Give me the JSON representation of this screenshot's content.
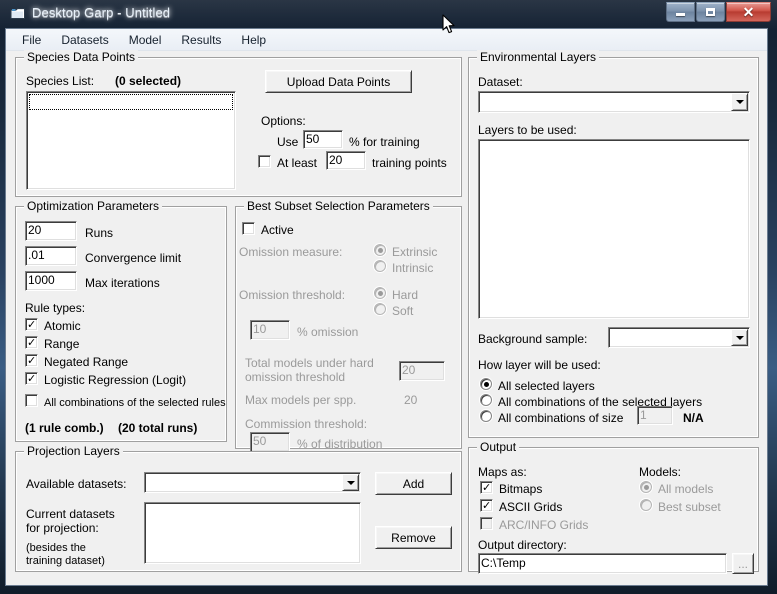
{
  "window": {
    "title": "Desktop Garp - Untitled",
    "icon": "document-window-icon",
    "minimize_label": "Minimize",
    "maximize_label": "Maximize",
    "close_label": "✕"
  },
  "menu": {
    "items": [
      {
        "label": "File"
      },
      {
        "label": "Datasets"
      },
      {
        "label": "Model"
      },
      {
        "label": "Results"
      },
      {
        "label": "Help"
      }
    ]
  },
  "species_data_points": {
    "title": "Species Data Points",
    "species_list_label": "Species List:",
    "selected_count_label": "(0 selected)",
    "species_list_value": "",
    "upload_button": "Upload Data Points",
    "options_label": "Options:",
    "use_label": "Use",
    "training_percent": "50",
    "percent_for_training_label": "% for training",
    "at_least_label": "At least",
    "at_least_checked": false,
    "min_training_points": "20",
    "training_points_label": "training points"
  },
  "optimization_parameters": {
    "title": "Optimization Parameters",
    "runs_value": "20",
    "runs_label": "Runs",
    "convergence_value": ".01",
    "convergence_label": "Convergence limit",
    "max_iterations_value": "1000",
    "max_iterations_label": "Max iterations",
    "rule_types_label": "Rule types:",
    "rules": [
      {
        "label": "Atomic",
        "checked": true
      },
      {
        "label": "Range",
        "checked": true
      },
      {
        "label": "Negated Range",
        "checked": true
      },
      {
        "label": "Logistic Regression (Logit)",
        "checked": true
      }
    ],
    "all_combinations_label": "All combinations of the selected rules",
    "all_combinations_checked": false,
    "rule_comb_summary": "(1 rule comb.)",
    "total_runs_summary": "(20 total runs)"
  },
  "best_subset": {
    "title": "Best Subset Selection Parameters",
    "active_label": "Active",
    "active_checked": false,
    "omission_measure_label": "Omission measure:",
    "omission_measure_options": [
      {
        "label": "Extrinsic",
        "selected": true
      },
      {
        "label": "Intrinsic",
        "selected": false
      }
    ],
    "omission_threshold_label": "Omission threshold:",
    "omission_threshold_options": [
      {
        "label": "Hard",
        "selected": true
      },
      {
        "label": "Soft",
        "selected": false
      }
    ],
    "percent_omission_value": "10",
    "percent_omission_label": "% omission",
    "total_models_label_line1": "Total models under hard",
    "total_models_label_line2": "omission threshold",
    "total_models_value": "20",
    "max_models_label": "Max models per spp.",
    "max_models_value": "20",
    "commission_threshold_label": "Commission threshold:",
    "commission_value": "50",
    "commission_suffix_label": "% of distribution"
  },
  "environmental_layers": {
    "title": "Environmental Layers",
    "dataset_label": "Dataset:",
    "dataset_value": "",
    "layers_label": "Layers to be used:",
    "layers_value": "",
    "background_sample_label": "Background sample:",
    "background_sample_value": "",
    "how_layer_label": "How layer will be used:",
    "usage_options": [
      {
        "label": "All selected layers",
        "selected": true
      },
      {
        "label": "All combinations of the selected layers",
        "selected": false
      },
      {
        "label": "All combinations of size",
        "selected": false
      }
    ],
    "combination_size_value": "1",
    "na_label": "N/A"
  },
  "projection_layers": {
    "title": "Projection Layers",
    "available_datasets_label": "Available datasets:",
    "available_datasets_value": "",
    "add_button": "Add",
    "current_datasets_label_line1": "Current datasets",
    "current_datasets_label_line2": "for projection:",
    "current_datasets_note_line1": "(besides the",
    "current_datasets_note_line2": "training dataset)",
    "current_datasets_value": "",
    "remove_button": "Remove"
  },
  "output": {
    "title": "Output",
    "maps_as_label": "Maps as:",
    "maps_options": [
      {
        "label": "Bitmaps",
        "checked": true,
        "enabled": true
      },
      {
        "label": "ASCII Grids",
        "checked": true,
        "enabled": true
      },
      {
        "label": "ARC/INFO Grids",
        "checked": false,
        "enabled": false
      }
    ],
    "models_label": "Models:",
    "models_options": [
      {
        "label": "All models",
        "selected": true
      },
      {
        "label": "Best subset",
        "selected": false
      }
    ],
    "output_directory_label": "Output directory:",
    "output_directory_value": "C:\\Temp",
    "browse_button": "..."
  },
  "colors": {
    "dialog_face": "#f0f0f0",
    "disabled_text": "#9a9a9a",
    "field_bg": "#ffffff",
    "close_button": "#c0392b"
  }
}
